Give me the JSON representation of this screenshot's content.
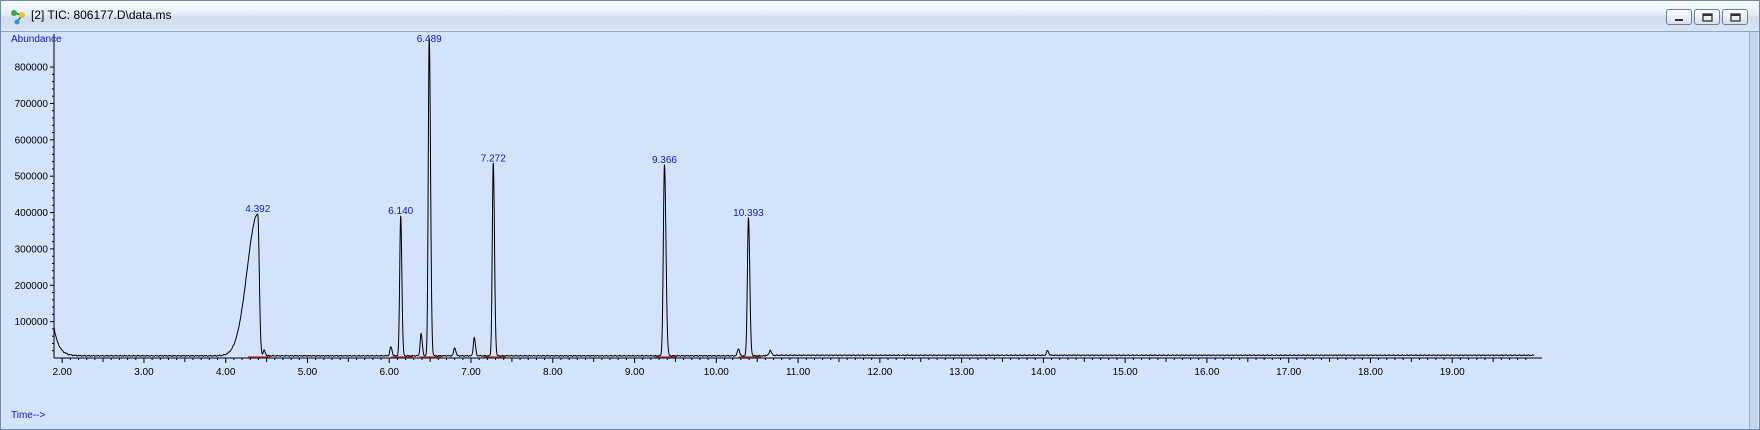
{
  "window": {
    "title": "[2] TIC: 806177.D\\data.ms",
    "app_icon": "chemstation-molecule-icon",
    "controls": [
      "minimize-icon",
      "restore-icon",
      "close-icon"
    ]
  },
  "colors": {
    "plot_bg": "#d2e3fb",
    "trace": "#000000",
    "label": "#1616c8",
    "baseline": "#d01818"
  },
  "chart_data": {
    "type": "line",
    "ylabel": "Abundance",
    "xlabel": "Time-->",
    "xlim": [
      1.9,
      20.0
    ],
    "ylim": [
      0,
      880000
    ],
    "x_ticks": [
      "2.00",
      "3.00",
      "4.00",
      "5.00",
      "6.00",
      "7.00",
      "8.00",
      "9.00",
      "10.00",
      "11.00",
      "12.00",
      "13.00",
      "14.00",
      "15.00",
      "16.00",
      "17.00",
      "18.00",
      "19.00"
    ],
    "y_ticks": [
      "100000",
      "200000",
      "300000",
      "400000",
      "500000",
      "600000",
      "700000",
      "800000"
    ],
    "baseline_level": 6000,
    "solvent_tail": {
      "start_x": 1.9,
      "start_y": 85000
    },
    "peaks": [
      {
        "rt": 4.392,
        "height": 390000,
        "label": "4.392",
        "width_left": 0.13,
        "width_right": 0.018
      },
      {
        "rt": 4.47,
        "height": 15000
      },
      {
        "rt": 6.02,
        "height": 25000
      },
      {
        "rt": 6.14,
        "height": 385000,
        "label": "6.140",
        "width_left": 0.012,
        "width_right": 0.014
      },
      {
        "rt": 6.39,
        "height": 60000
      },
      {
        "rt": 6.489,
        "height": 875000,
        "label": "6.489",
        "width_left": 0.012,
        "width_right": 0.016
      },
      {
        "rt": 6.8,
        "height": 22000
      },
      {
        "rt": 7.04,
        "height": 50000
      },
      {
        "rt": 7.272,
        "height": 530000,
        "label": "7.272",
        "width_left": 0.012,
        "width_right": 0.015
      },
      {
        "rt": 9.366,
        "height": 525000,
        "label": "9.366",
        "width_left": 0.014,
        "width_right": 0.018
      },
      {
        "rt": 10.27,
        "height": 20000
      },
      {
        "rt": 10.393,
        "height": 380000,
        "label": "10.393",
        "width_left": 0.013,
        "width_right": 0.016
      },
      {
        "rt": 10.66,
        "height": 14000
      },
      {
        "rt": 14.05,
        "height": 13000
      }
    ]
  }
}
